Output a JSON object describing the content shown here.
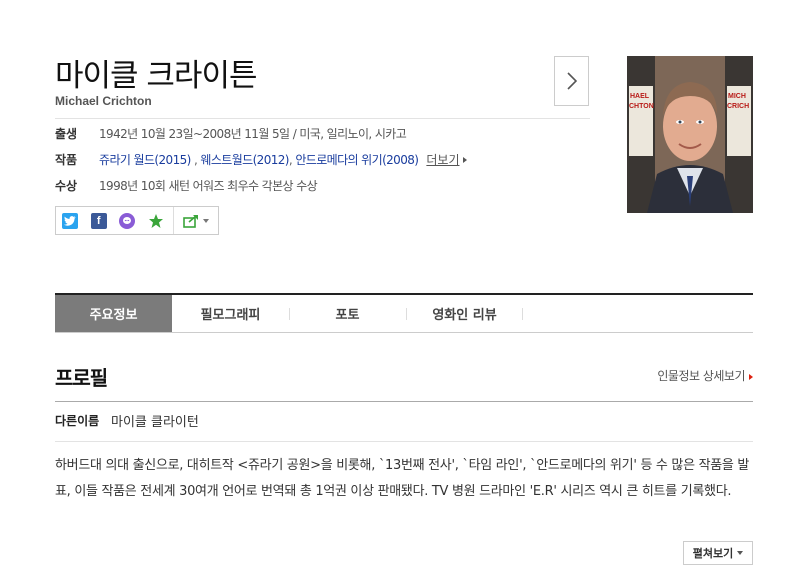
{
  "person": {
    "name_ko": "마이클 크라이튼",
    "name_en": "Michael Crichton"
  },
  "info": {
    "birth_label": "출생",
    "birth_value": "1942년 10월 23일~2008년 11월 5일 / 미국, 일리노이, 시카고",
    "works_label": "작품",
    "works": [
      "쥬라기 월드(2015)",
      "웨스트월드(2012)",
      "안드로메다의 위기(2008)"
    ],
    "works_sep": ",",
    "works_more": "더보기",
    "award_label": "수상",
    "award_value": "1998년 10회 새턴 어워즈 최우수 각본상 수상"
  },
  "share": {
    "twitter_glyph": "t",
    "facebook_glyph": "f",
    "icons": [
      "twitter-icon",
      "facebook-icon",
      "messenger-icon",
      "star-icon",
      "share-icon"
    ]
  },
  "colors": {
    "twitter": "#2aa3ef",
    "facebook": "#3b5998",
    "messenger": "#8a5cd6",
    "star": "#3aa53a",
    "share": "#3aa53a",
    "tab_active_bg": "#7b7b7b",
    "link_blue": "#1a3d9e"
  },
  "tabs": [
    {
      "label": "주요정보",
      "active": true
    },
    {
      "label": "필모그래피",
      "active": false
    },
    {
      "label": "포토",
      "active": false
    },
    {
      "label": "영화인 리뷰",
      "active": false
    }
  ],
  "profile": {
    "title": "프로필",
    "detail_link": "인물정보 상세보기",
    "alias_label": "다른이름",
    "alias_value": "마이클 클라이턴",
    "bio": "하버드대 의대 출신으로, 대히트작 <쥬라기 공원>을 비롯해, `13번째 전사', `타임 라인', `안드로메다의 위기' 등 수 많은 작품을 발표, 이들 작품은 전세계 30여개 언어로 번역돼 총 1억권 이상 판매됐다. TV 병원 드라마인 'E.R' 시리즈 역시 큰 히트를 기록했다.",
    "expand_label": "펼쳐보기"
  }
}
